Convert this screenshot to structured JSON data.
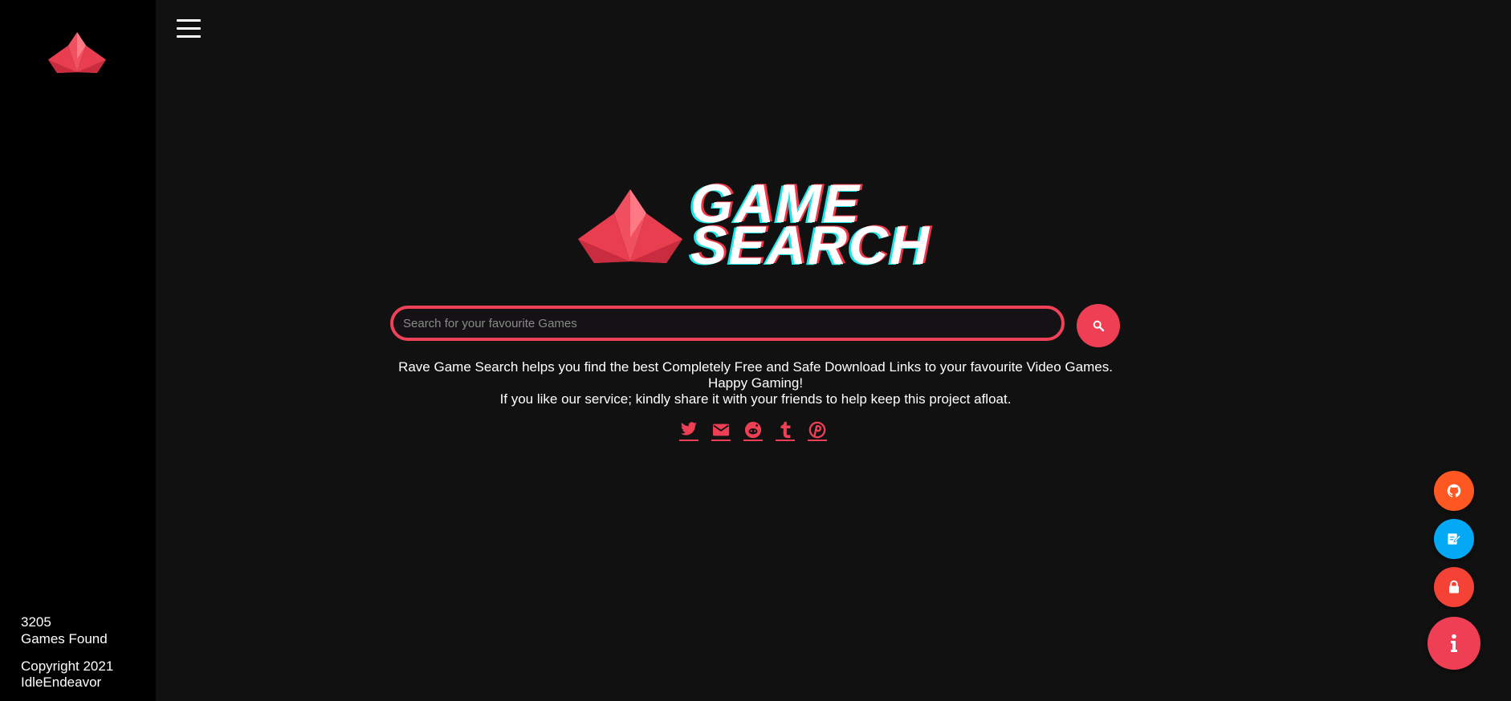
{
  "sidebar": {
    "logo_icon": "crystal-logo-icon",
    "stats": {
      "count": "3205",
      "label": "Games Found"
    },
    "copyright": {
      "line1": "Copyright 2021",
      "line2": "IdleEndeavor"
    }
  },
  "header": {
    "menu_icon": "hamburger-menu-icon"
  },
  "hero": {
    "brand_line1": "GAME",
    "brand_line2": "SEARCH",
    "logo_icon": "crystal-logo-icon"
  },
  "search": {
    "placeholder": "Search for your favourite Games",
    "value": "",
    "button_icon": "search-icon"
  },
  "description": {
    "line1": "Rave Game Search helps you find the best Completely Free and Safe Download Links to your favourite Video Games.",
    "line2": "Happy Gaming!",
    "line3": "If you like our service; kindly share it with your friends to help keep this project afloat."
  },
  "share": [
    {
      "icon": "twitter-icon"
    },
    {
      "icon": "email-icon"
    },
    {
      "icon": "reddit-icon"
    },
    {
      "icon": "tumblr-icon"
    },
    {
      "icon": "pinterest-icon"
    }
  ],
  "fabs": [
    {
      "icon": "github-icon",
      "color": "#ff5722"
    },
    {
      "icon": "edit-icon",
      "color": "#03a9f4"
    },
    {
      "icon": "lock-icon",
      "color": "#f44336"
    },
    {
      "icon": "info-icon",
      "color": "#ef3f55"
    }
  ],
  "colors": {
    "accent": "#ef3f55",
    "background": "#121112",
    "sidebar": "#000000",
    "glitch_cyan": "#19e6e6"
  }
}
